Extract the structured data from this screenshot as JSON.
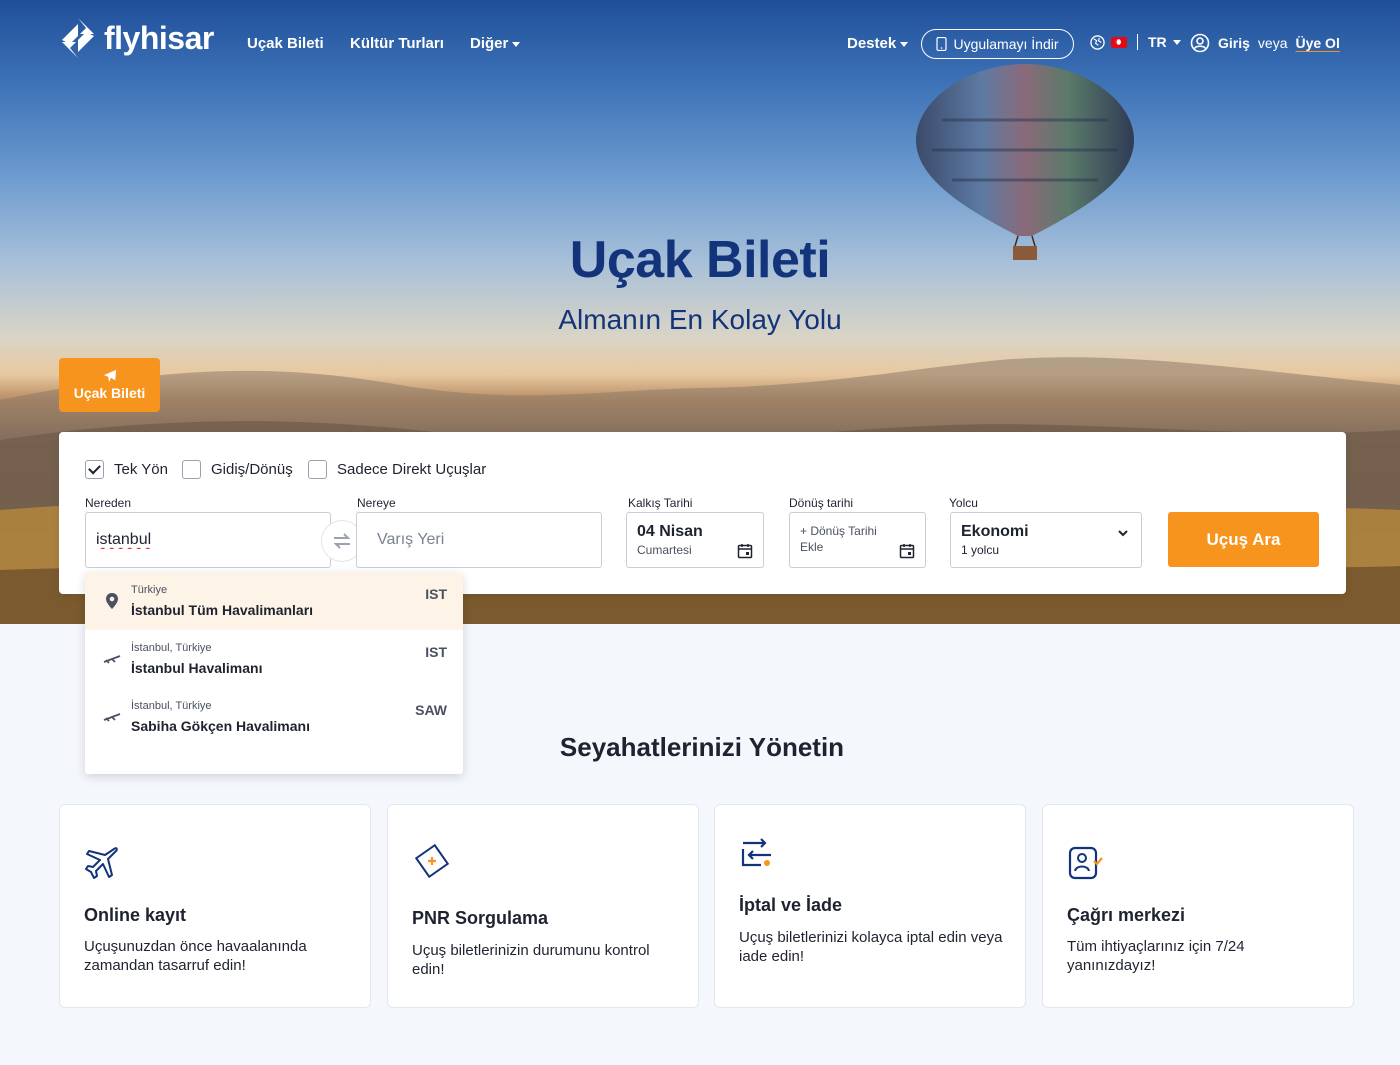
{
  "brand": {
    "name": "flyhisar",
    "accent": "#f7941d",
    "navy": "#13347a"
  },
  "nav": {
    "links": [
      "Uçak Bileti",
      "Kültür Turları",
      "Diğer"
    ],
    "support": "Destek",
    "app_download": "Uygulamayı İndir",
    "language": "TR",
    "login": "Giriş",
    "or": "veya",
    "signup": "Üye Ol"
  },
  "hero": {
    "title": "Uçak Bileti",
    "subtitle": "Almanın En Kolay Yolu",
    "tab_label": "Uçak Bileti"
  },
  "search": {
    "options": [
      {
        "label": "Tek Yön",
        "checked": true
      },
      {
        "label": "Gidiş/Dönüş",
        "checked": false
      },
      {
        "label": "Sadece Direkt Uçuşlar",
        "checked": false
      }
    ],
    "from_label": "Nereden",
    "from_value": "istanbul",
    "to_label": "Nereye",
    "to_placeholder": "Varış Yeri",
    "depart_label": "Kalkış Tarihi",
    "depart_date": "04 Nisan",
    "depart_day": "Cumartesi",
    "return_label": "Dönüş tarihi",
    "return_value": "+ Dönüş Tarihi Ekle",
    "passenger_label": "Yolcu",
    "cabin": "Ekonomi",
    "passengers": "1 yolcu",
    "search_button": "Uçuş Ara"
  },
  "suggestions": [
    {
      "sub": "Türkiye",
      "name": "İstanbul Tüm Havalimanları",
      "code": "IST",
      "icon": "location-pin-icon",
      "highlighted": true
    },
    {
      "sub": "İstanbul, Türkiye",
      "name": "İstanbul Havalimanı",
      "code": "IST",
      "icon": "airplane-icon",
      "highlighted": false
    },
    {
      "sub": "İstanbul, Türkiye",
      "name": "Sabiha Gökçen Havalimanı",
      "code": "SAW",
      "icon": "airplane-icon",
      "highlighted": false
    }
  ],
  "manage": {
    "title": "Seyahatlerinizi Yönetin",
    "cards": [
      {
        "title": "Online kayıt",
        "desc": "Uçuşunuzdan önce havaalanında zamandan tasarruf edin!",
        "icon": "plane-checkin-icon"
      },
      {
        "title": "PNR Sorgulama",
        "desc": "Uçuş biletlerinizin durumunu kontrol edin!",
        "icon": "ticket-icon"
      },
      {
        "title": "İptal ve İade",
        "desc": "Uçuş biletlerinizi kolayca iptal edin veya\niade edin!",
        "icon": "refund-arrows-icon"
      },
      {
        "title": "Çağrı merkezi",
        "desc": "Tüm ihtiyaçlarınız için 7/24 yanınızdayız!",
        "icon": "call-center-icon"
      }
    ]
  }
}
